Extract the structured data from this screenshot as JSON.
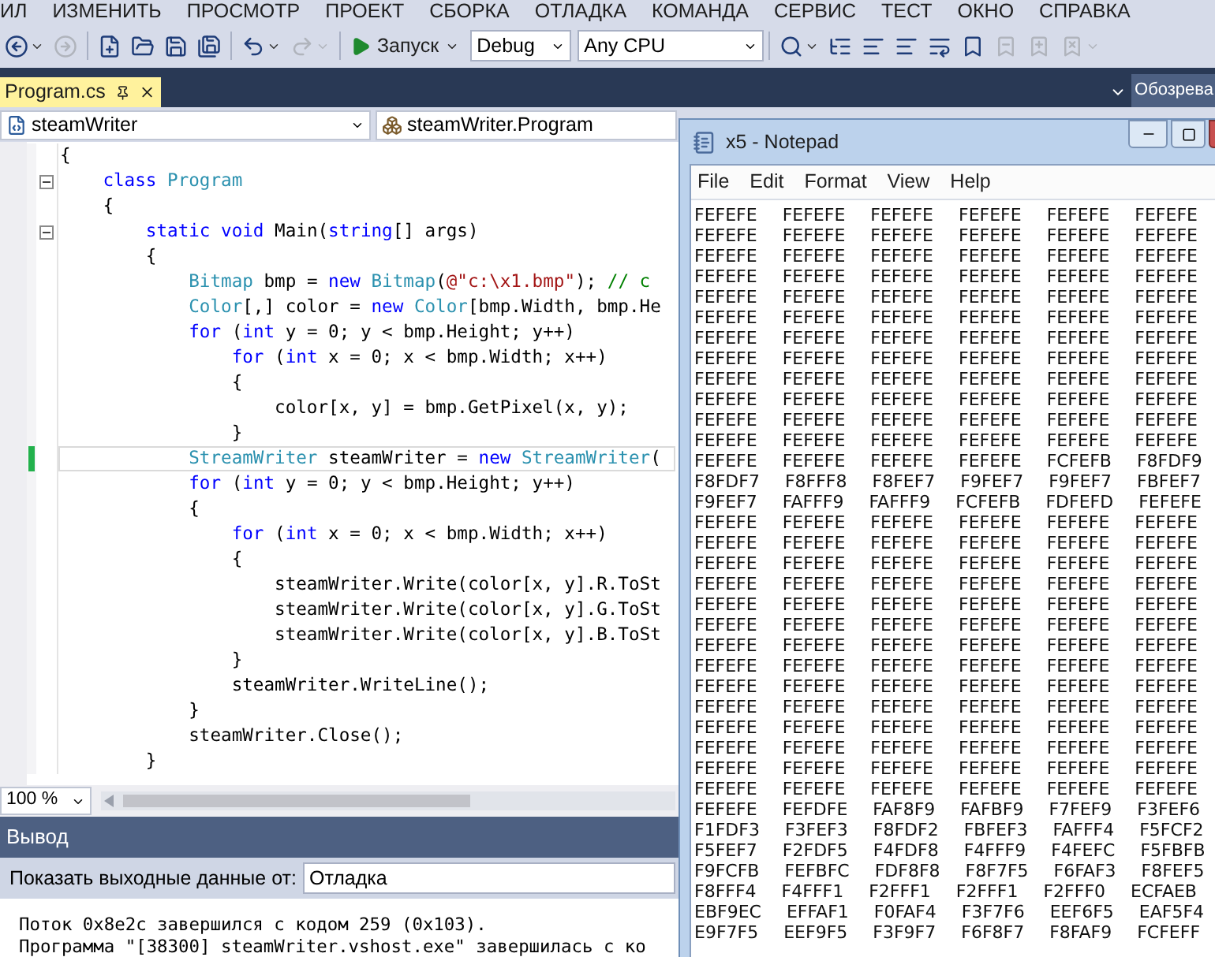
{
  "menu": [
    "ИЛ",
    "ИЗМЕНИТЬ",
    "ПРОСМОТР",
    "ПРОЕКТ",
    "СБОРКА",
    "ОТЛАДКА",
    "КОМАНДА",
    "СЕРВИС",
    "ТЕСТ",
    "ОКНО",
    "СПРАВКА"
  ],
  "toolbar": {
    "left_buttons": [
      {
        "kind": "back",
        "disabled": false,
        "dropdown": true
      },
      {
        "kind": "forward",
        "disabled": true,
        "dropdown": false
      },
      {
        "kind": "new",
        "disabled": false,
        "dropdown": false
      },
      {
        "kind": "open",
        "disabled": false,
        "dropdown": false
      },
      {
        "kind": "save",
        "disabled": false,
        "dropdown": false
      },
      {
        "kind": "save_all",
        "disabled": false,
        "dropdown": false
      },
      {
        "kind": "undo",
        "disabled": false,
        "dropdown": true
      },
      {
        "kind": "redo",
        "disabled": true,
        "dropdown": true
      }
    ],
    "run": {
      "label": "Запуск"
    },
    "configuration": "Debug",
    "platform": "Any CPU",
    "right_buttons": [
      {
        "kind": "find",
        "disabled": false,
        "dropdown": true
      },
      {
        "kind": "tree",
        "disabled": false,
        "dropdown": false
      },
      {
        "kind": "list",
        "disabled": false,
        "dropdown": false
      },
      {
        "kind": "align",
        "disabled": false,
        "dropdown": false
      },
      {
        "kind": "wrap",
        "disabled": false,
        "dropdown": false
      },
      {
        "kind": "bookmark",
        "disabled": false,
        "dropdown": false
      },
      {
        "kind": "bookmark_prev",
        "disabled": true,
        "dropdown": false
      },
      {
        "kind": "bookmark_next",
        "disabled": true,
        "dropdown": false
      },
      {
        "kind": "bookmark_clear",
        "disabled": true,
        "dropdown": true
      }
    ]
  },
  "tabs": [
    {
      "label": "Program.cs",
      "selected": true
    }
  ],
  "side_tab": {
    "label": "Обозрева"
  },
  "navigation": {
    "project": "steamWriter",
    "type": "steamWriter.Program"
  },
  "editor": {
    "lines": [
      {
        "changed": false,
        "current": false,
        "collapsible": false,
        "segments": [
          {
            "kind": "plain",
            "text": "{"
          }
        ]
      },
      {
        "changed": false,
        "current": false,
        "collapsible": true,
        "segments": [
          {
            "kind": "keyword",
            "text": "    class"
          },
          {
            "kind": "type",
            "text": " Program"
          }
        ]
      },
      {
        "changed": false,
        "current": false,
        "collapsible": false,
        "segments": [
          {
            "kind": "plain",
            "text": "    {"
          }
        ]
      },
      {
        "changed": false,
        "current": false,
        "collapsible": true,
        "segments": [
          {
            "kind": "keyword",
            "text": "        static void"
          },
          {
            "kind": "plain",
            "text": " Main("
          },
          {
            "kind": "keyword",
            "text": "string"
          },
          {
            "kind": "plain",
            "text": "[] args)"
          }
        ]
      },
      {
        "changed": false,
        "current": false,
        "collapsible": false,
        "segments": [
          {
            "kind": "plain",
            "text": "        {"
          }
        ]
      },
      {
        "changed": false,
        "current": false,
        "collapsible": false,
        "segments": [
          {
            "kind": "type",
            "text": "            Bitmap"
          },
          {
            "kind": "plain",
            "text": " bmp = "
          },
          {
            "kind": "keyword",
            "text": "new"
          },
          {
            "kind": "type",
            "text": " Bitmap"
          },
          {
            "kind": "plain",
            "text": "("
          },
          {
            "kind": "string",
            "text": "@\"c:\\x1.bmp\""
          },
          {
            "kind": "plain",
            "text": "); "
          },
          {
            "kind": "comment",
            "text": "// c"
          }
        ]
      },
      {
        "changed": false,
        "current": false,
        "collapsible": false,
        "segments": [
          {
            "kind": "type",
            "text": "            Color"
          },
          {
            "kind": "plain",
            "text": "[,] color = "
          },
          {
            "kind": "keyword",
            "text": "new"
          },
          {
            "kind": "type",
            "text": " Color"
          },
          {
            "kind": "plain",
            "text": "[bmp.Width, bmp.He"
          }
        ]
      },
      {
        "changed": false,
        "current": false,
        "collapsible": false,
        "segments": [
          {
            "kind": "keyword",
            "text": "            for"
          },
          {
            "kind": "plain",
            "text": " ("
          },
          {
            "kind": "keyword",
            "text": "int"
          },
          {
            "kind": "plain",
            "text": " y = 0; y < bmp.Height; y++)"
          }
        ]
      },
      {
        "changed": false,
        "current": false,
        "collapsible": false,
        "segments": [
          {
            "kind": "keyword",
            "text": "                for"
          },
          {
            "kind": "plain",
            "text": " ("
          },
          {
            "kind": "keyword",
            "text": "int"
          },
          {
            "kind": "plain",
            "text": " x = 0; x < bmp.Width; x++)"
          }
        ]
      },
      {
        "changed": false,
        "current": false,
        "collapsible": false,
        "segments": [
          {
            "kind": "plain",
            "text": "                {"
          }
        ]
      },
      {
        "changed": false,
        "current": false,
        "collapsible": false,
        "segments": [
          {
            "kind": "plain",
            "text": "                    color[x, y] = bmp.GetPixel(x, y);"
          }
        ]
      },
      {
        "changed": false,
        "current": false,
        "collapsible": false,
        "segments": [
          {
            "kind": "plain",
            "text": "                }"
          }
        ]
      },
      {
        "changed": true,
        "current": true,
        "collapsible": false,
        "segments": [
          {
            "kind": "type",
            "text": "            StreamWriter"
          },
          {
            "kind": "plain",
            "text": " steamWriter = "
          },
          {
            "kind": "keyword",
            "text": "new"
          },
          {
            "kind": "type",
            "text": " StreamWriter"
          },
          {
            "kind": "plain",
            "text": "("
          }
        ]
      },
      {
        "changed": false,
        "current": false,
        "collapsible": false,
        "segments": [
          {
            "kind": "keyword",
            "text": "            for"
          },
          {
            "kind": "plain",
            "text": " ("
          },
          {
            "kind": "keyword",
            "text": "int"
          },
          {
            "kind": "plain",
            "text": " y = 0; y < bmp.Height; y++)"
          }
        ]
      },
      {
        "changed": false,
        "current": false,
        "collapsible": false,
        "segments": [
          {
            "kind": "plain",
            "text": "            {"
          }
        ]
      },
      {
        "changed": false,
        "current": false,
        "collapsible": false,
        "segments": [
          {
            "kind": "keyword",
            "text": "                for"
          },
          {
            "kind": "plain",
            "text": " ("
          },
          {
            "kind": "keyword",
            "text": "int"
          },
          {
            "kind": "plain",
            "text": " x = 0; x < bmp.Width; x++)"
          }
        ]
      },
      {
        "changed": false,
        "current": false,
        "collapsible": false,
        "segments": [
          {
            "kind": "plain",
            "text": "                {"
          }
        ]
      },
      {
        "changed": false,
        "current": false,
        "collapsible": false,
        "segments": [
          {
            "kind": "plain",
            "text": "                    steamWriter.Write(color[x, y].R.ToSt"
          }
        ]
      },
      {
        "changed": false,
        "current": false,
        "collapsible": false,
        "segments": [
          {
            "kind": "plain",
            "text": "                    steamWriter.Write(color[x, y].G.ToSt"
          }
        ]
      },
      {
        "changed": false,
        "current": false,
        "collapsible": false,
        "segments": [
          {
            "kind": "plain",
            "text": "                    steamWriter.Write(color[x, y].B.ToSt"
          }
        ]
      },
      {
        "changed": false,
        "current": false,
        "collapsible": false,
        "segments": [
          {
            "kind": "plain",
            "text": "                }"
          }
        ]
      },
      {
        "changed": false,
        "current": false,
        "collapsible": false,
        "segments": [
          {
            "kind": "plain",
            "text": "                steamWriter.WriteLine();"
          }
        ]
      },
      {
        "changed": false,
        "current": false,
        "collapsible": false,
        "segments": [
          {
            "kind": "plain",
            "text": "            }"
          }
        ]
      },
      {
        "changed": false,
        "current": false,
        "collapsible": false,
        "segments": [
          {
            "kind": "plain",
            "text": "            steamWriter.Close();"
          }
        ]
      },
      {
        "changed": false,
        "current": false,
        "collapsible": false,
        "segments": [
          {
            "kind": "plain",
            "text": "        }"
          }
        ]
      }
    ],
    "zoom": "100 %"
  },
  "output": {
    "title": "Вывод",
    "filter_label": "Показать выходные данные от:",
    "filter_value": "Отладка",
    "lines": [
      "Поток 0x8e2c завершился с кодом 259 (0x103).",
      "Программа \"[38300] steamWriter.vshost.exe\" завершилась с ко"
    ]
  },
  "notepad": {
    "title": "x5 - Notepad",
    "menu": [
      "File",
      "Edit",
      "Format",
      "View",
      "Help"
    ],
    "rows": [
      "FEFEFE FEFEFE FEFEFE FEFEFE FEFEFE FEFEFE",
      "FEFEFE FEFEFE FEFEFE FEFEFE FEFEFE FEFEFE",
      "FEFEFE FEFEFE FEFEFE FEFEFE FEFEFE FEFEFE",
      "FEFEFE FEFEFE FEFEFE FEFEFE FEFEFE FEFEFE",
      "FEFEFE FEFEFE FEFEFE FEFEFE FEFEFE FEFEFE",
      "FEFEFE FEFEFE FEFEFE FEFEFE FEFEFE FEFEFE",
      "FEFEFE FEFEFE FEFEFE FEFEFE FEFEFE FEFEFE",
      "FEFEFE FEFEFE FEFEFE FEFEFE FEFEFE FEFEFE",
      "FEFEFE FEFEFE FEFEFE FEFEFE FEFEFE FEFEFE",
      "FEFEFE FEFEFE FEFEFE FEFEFE FEFEFE FEFEFE",
      "FEFEFE FEFEFE FEFEFE FEFEFE FEFEFE FEFEFE",
      "FEFEFE FEFEFE FEFEFE FEFEFE FEFEFE FEFEFE",
      "FEFEFE FEFEFE FEFEFE FEFEFE FCFEFB F8FDF9",
      "F8FDF7 F8FFF8 F8FEF7 F9FEF7 F9FEF7 FBFEF7",
      "F9FEF7 FAFFF9 FAFFF9 FCFEFB FDFEFD FEFEFE",
      "FEFEFE FEFEFE FEFEFE FEFEFE FEFEFE FEFEFE",
      "FEFEFE FEFEFE FEFEFE FEFEFE FEFEFE FEFEFE",
      "FEFEFE FEFEFE FEFEFE FEFEFE FEFEFE FEFEFE",
      "FEFEFE FEFEFE FEFEFE FEFEFE FEFEFE FEFEFE",
      "FEFEFE FEFEFE FEFEFE FEFEFE FEFEFE FEFEFE",
      "FEFEFE FEFEFE FEFEFE FEFEFE FEFEFE FEFEFE",
      "FEFEFE FEFEFE FEFEFE FEFEFE FEFEFE FEFEFE",
      "FEFEFE FEFEFE FEFEFE FEFEFE FEFEFE FEFEFE",
      "FEFEFE FEFEFE FEFEFE FEFEFE FEFEFE FEFEFE",
      "FEFEFE FEFEFE FEFEFE FEFEFE FEFEFE FEFEFE",
      "FEFEFE FEFEFE FEFEFE FEFEFE FEFEFE FEFEFE",
      "FEFEFE FEFEFE FEFEFE FEFEFE FEFEFE FEFEFE",
      "FEFEFE FEFEFE FEFEFE FEFEFE FEFEFE FEFEFE",
      "FEFEFE FEFEFE FEFEFE FEFEFE FEFEFE FEFEFE",
      "FEFEFE FEFDFE FAF8F9 FAFBF9 F7FEF9 F3FEF6",
      "F1FDF3 F3FEF3 F8FDF2 FBFEF3 FAFFF4 F5FCF2",
      "F5FEF7 F2FDF5 F4FDF8 F4FFF9 F4FEFC F5FBFB",
      "F9FCFB FEFBFC FDF8F8 F8F7F5 F6FAF3 F8FEF5",
      "F8FFF4 F4FFF1 F2FFF1 F2FFF1 F2FFF0 ECFAEB",
      "EBF9EC EFFAF1 F0FAF4 F3F7F6 EEF6F5 EAF5F4",
      "E9F7F5 EEF9F5 F3F9F7 F6F8F7 F8FAF9 FCFEFF"
    ]
  }
}
